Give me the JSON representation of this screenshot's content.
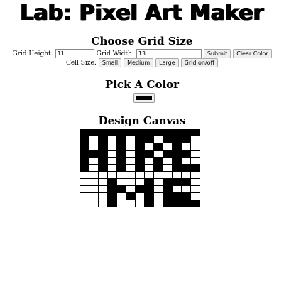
{
  "page_title": "Lab: Pixel Art Maker",
  "grid_section": {
    "heading": "Choose Grid Size",
    "height_label": "Grid Height:",
    "height_value": "11",
    "width_label": "Grid Width:",
    "width_value": "13",
    "submit_label": "Submit",
    "clear_label": "Clear Color",
    "cell_size_label": "Cell Size:",
    "size_buttons": [
      "Small",
      "Medium",
      "Large",
      "Grid on/off"
    ]
  },
  "color_section": {
    "heading": "Pick A Color",
    "selected_color": "#000000"
  },
  "canvas_section": {
    "heading": "Design Canvas",
    "pixels": [
      "1111111111111",
      "1010101101110",
      "1010101010100",
      "1110101101110",
      "1010101010100",
      "1010101010111",
      "0000000000000",
      "0001000101110",
      "0001101101000",
      "0001010101110",
      "0001000101111"
    ]
  }
}
